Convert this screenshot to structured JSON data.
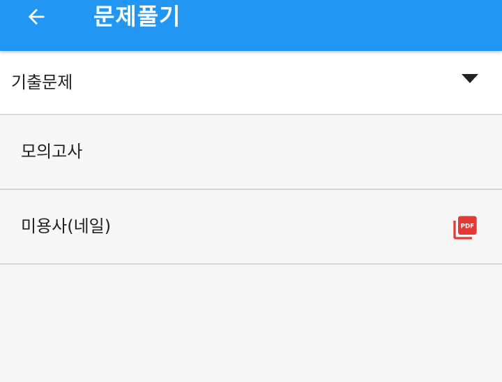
{
  "appbar": {
    "title": "문제풀기",
    "back_icon": "arrow-back-icon",
    "background": "#2196f3"
  },
  "category_select": {
    "selected": "기출문제",
    "icon": "caret-down-icon"
  },
  "items": [
    {
      "label": "모의고사"
    },
    {
      "label": "미용사(네일)",
      "icon": "pdf-icon",
      "icon_color": "#e53935"
    }
  ]
}
